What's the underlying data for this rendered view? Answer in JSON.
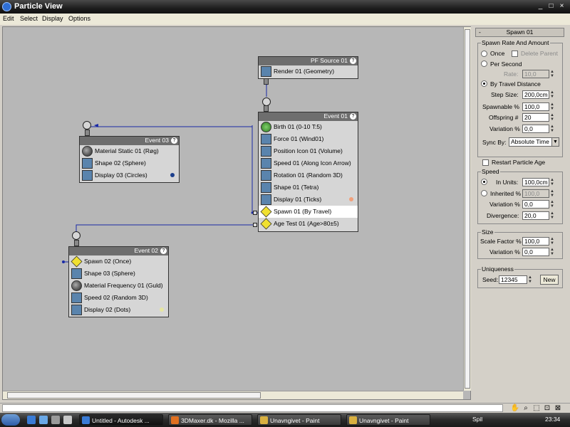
{
  "window": {
    "title": "Particle View",
    "controls": [
      "_",
      "□",
      "×"
    ]
  },
  "menu": [
    "Edit",
    "Select",
    "Display",
    "Options"
  ],
  "canvas": {
    "pf_source": {
      "title": "PF Source 01",
      "operators": [
        {
          "label": "Render 01 (Geometry)",
          "icon": "render-icon"
        }
      ]
    },
    "event01": {
      "title": "Event 01",
      "operators": [
        {
          "label": "Birth 01 (0-10 T:5)",
          "icon": "birth-icon"
        },
        {
          "label": "Force 01 (Wind01)",
          "icon": "force-icon"
        },
        {
          "label": "Position Icon 01 (Volume)",
          "icon": "position-icon"
        },
        {
          "label": "Speed 01 (Along Icon Arrow)",
          "icon": "speed-icon"
        },
        {
          "label": "Rotation 01 (Random 3D)",
          "icon": "rotation-icon"
        },
        {
          "label": "Shape 01 (Tetra)",
          "icon": "shape-icon"
        },
        {
          "label": "Display 01 (Ticks)",
          "icon": "display-icon",
          "dot": "#f2a07a"
        },
        {
          "label": "Spawn 01 (By Travel)",
          "icon": "spawn-icon",
          "selected": true
        },
        {
          "label": "Age Test 01 (Age>80±5)",
          "icon": "age-test-icon"
        }
      ]
    },
    "event02": {
      "title": "Event 02",
      "operators": [
        {
          "label": "Spawn 02 (Once)",
          "icon": "spawn-icon"
        },
        {
          "label": "Shape 03 (Sphere)",
          "icon": "shape-icon"
        },
        {
          "label": "Material Frequency 01 (Guld)",
          "icon": "material-icon"
        },
        {
          "label": "Speed 02 (Random 3D)",
          "icon": "speed-icon"
        },
        {
          "label": "Display 02 (Dots)",
          "icon": "display-icon",
          "dot": "#e6e6a0"
        }
      ]
    },
    "event03": {
      "title": "Event 03",
      "operators": [
        {
          "label": "Material Static 01 (Røg)",
          "icon": "material-icon"
        },
        {
          "label": "Shape 02 (Sphere)",
          "icon": "shape-icon"
        },
        {
          "label": "Display 03 (Circles)",
          "icon": "display-icon",
          "dot": "#1c3f8c"
        }
      ]
    }
  },
  "panel": {
    "rollout_title": "Spawn 01",
    "rollout_toggle": "-",
    "spawn_rate_group": "Spawn Rate And Amount",
    "once_label": "Once",
    "delete_parent_label": "Delete Parent",
    "per_second_label": "Per Second",
    "rate_label": "Rate:",
    "rate_value": "10,0",
    "by_travel_label": "By Travel Distance",
    "step_size_label": "Step Size:",
    "step_size_value": "200,0cm",
    "spawnable_label": "Spawnable %",
    "spawnable_value": "100,0",
    "offspring_label": "Offspring #",
    "offspring_value": "20",
    "variation_label": "Variation %",
    "variation_value": "0,0",
    "sync_by_label": "Sync By:",
    "sync_by_value": "Absolute Time",
    "restart_label": "Restart Particle Age",
    "speed_group": "Speed",
    "in_units_label": "In Units:",
    "in_units_value": "100,0cm",
    "inherited_label": "Inherited %",
    "inherited_value": "100,0",
    "speed_variation_label": "Variation %",
    "speed_variation_value": "0,0",
    "divergence_label": "Divergence:",
    "divergence_value": "20,0",
    "size_group": "Size",
    "scale_factor_label": "Scale Factor %",
    "scale_factor_value": "100,0",
    "size_variation_label": "Variation %",
    "size_variation_value": "0,0",
    "uniqueness_group": "Uniqueness",
    "seed_label": "Seed:",
    "seed_value": "12345",
    "new_button": "New"
  },
  "statusbar": {
    "tools": [
      "pan-icon",
      "zoom-icon",
      "zoom-region-icon",
      "zoom-extents-icon",
      "no-zoom-icon"
    ]
  },
  "taskbar": {
    "tasks": [
      {
        "label": "Untitled - Autodesk ...",
        "active": true,
        "icon_color": "#3a7bd5"
      },
      {
        "label": "3DMaxer.dk - Mozilla ...",
        "active": false,
        "icon_color": "#e07020"
      },
      {
        "label": "Unavngivet - Paint",
        "active": false,
        "icon_color": "#d9b040"
      },
      {
        "label": "Unavngivet - Paint",
        "active": false,
        "icon_color": "#d9b040"
      }
    ],
    "language": "Spil",
    "clock": "23:34"
  }
}
